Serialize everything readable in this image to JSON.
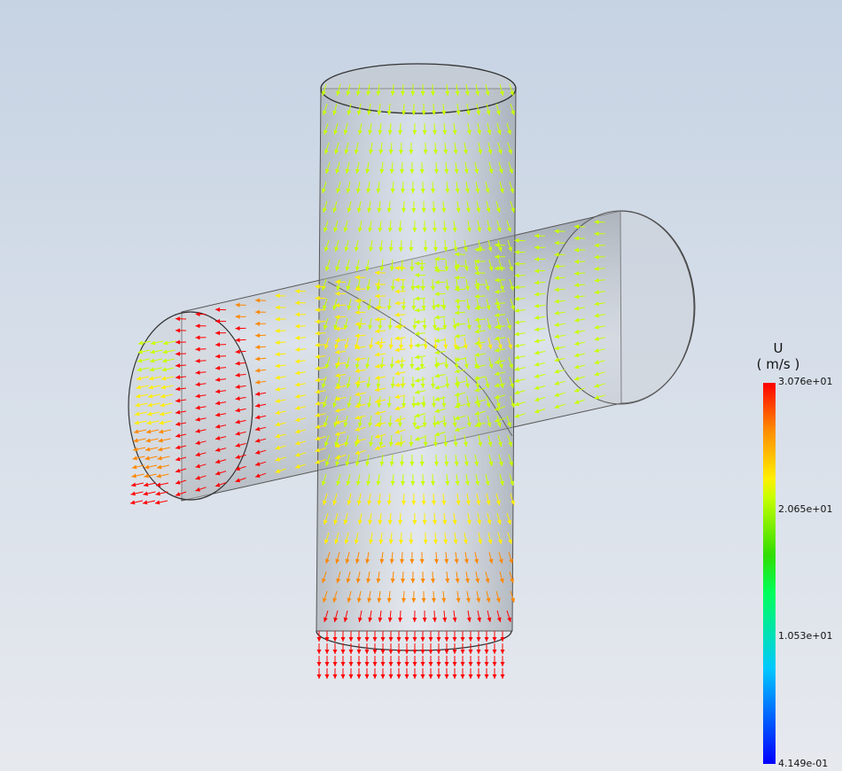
{
  "legend": {
    "variable": "U",
    "unit": "( m/s )",
    "ticks": [
      "3.076e+01",
      "2.065e+01",
      "1.053e+01",
      "4.149e-01"
    ],
    "min": 0.4149,
    "max": 30.76
  },
  "scene": {
    "object": "cross-pipe-junction",
    "vector-color-map": [
      "#0000ff",
      "#00c8ff",
      "#00ff5a",
      "#33dd00",
      "#c8ff00",
      "#ffee00",
      "#ff8800",
      "#ff0000"
    ],
    "pipe-tint": "#b8b8b8"
  }
}
